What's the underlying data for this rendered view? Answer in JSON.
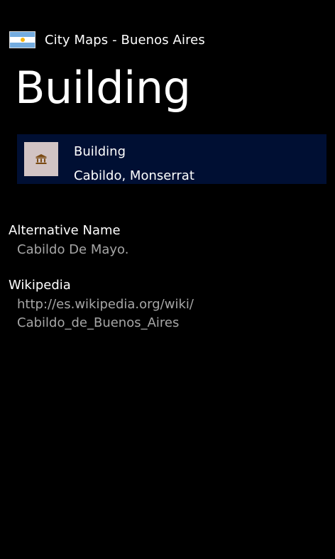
{
  "app": {
    "title": "City Maps - Buenos Aires",
    "flag_colors": {
      "blue": "#74acdf",
      "white": "#ffffff",
      "sun": "#f6b40e"
    }
  },
  "page": {
    "title": "Building"
  },
  "summary_card": {
    "background": "#000f33",
    "tile_background": "#d2c4c4",
    "icon_color": "#7a4a12",
    "icon": "building-icon",
    "category": "Building",
    "location": "Cabildo, Monserrat"
  },
  "details": {
    "value_color": "#a6a6a6",
    "alternative_name": {
      "label": "Alternative Name",
      "value": "Cabildo De Mayo."
    },
    "wikipedia": {
      "label": "Wikipedia",
      "value_line1": "http://es.wikipedia.org/wiki/",
      "value_line2": "Cabildo_de_Buenos_Aires"
    }
  }
}
